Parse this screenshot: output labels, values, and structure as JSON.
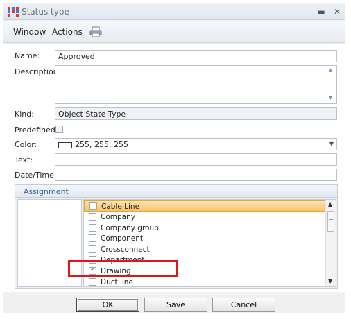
{
  "window": {
    "title": "Status type"
  },
  "menu": {
    "window": "Window",
    "actions": "Actions"
  },
  "form": {
    "name_label": "Name:",
    "name_value": "Approved",
    "description_label": "Description:",
    "description_value": "",
    "kind_label": "Kind:",
    "kind_value": "Object State Type",
    "predefined_label": "Predefined:",
    "predefined_checked": false,
    "color_label": "Color:",
    "color_value": "255, 255, 255",
    "text_label": "Text:",
    "text_value": "",
    "datetime_label": "Date/Time:",
    "datetime_value": ""
  },
  "assignment": {
    "title": "Assignment",
    "items": [
      {
        "label": "Cable Line",
        "checked": false,
        "selected": true
      },
      {
        "label": "Company",
        "checked": false,
        "selected": false
      },
      {
        "label": "Company group",
        "checked": false,
        "selected": false
      },
      {
        "label": "Component",
        "checked": false,
        "selected": false
      },
      {
        "label": "Crossconnect",
        "checked": false,
        "selected": false
      },
      {
        "label": "Department",
        "checked": false,
        "selected": false
      },
      {
        "label": "Drawing",
        "checked": true,
        "selected": false
      },
      {
        "label": "Duct line",
        "checked": false,
        "selected": false
      }
    ]
  },
  "buttons": {
    "ok": "OK",
    "save": "Save",
    "cancel": "Cancel"
  },
  "colors": {
    "highlight": "#e0141a",
    "selection": "#f9c46e",
    "accent": "#3c6ea5"
  }
}
